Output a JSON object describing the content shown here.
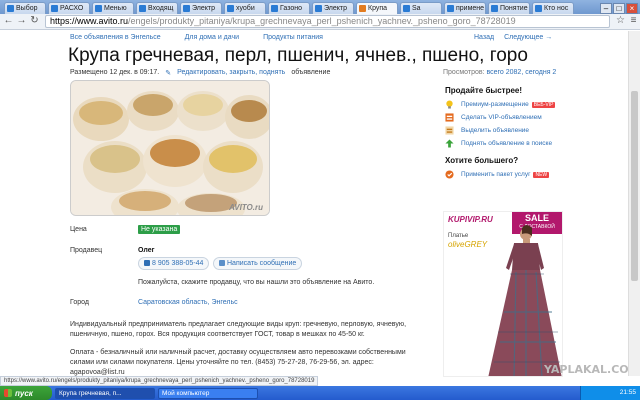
{
  "browser": {
    "tabs": [
      {
        "label": "Выбор"
      },
      {
        "label": "РАСХО"
      },
      {
        "label": "Менью"
      },
      {
        "label": "Входящ"
      },
      {
        "label": "Электр"
      },
      {
        "label": "хуоби"
      },
      {
        "label": "Газоно"
      },
      {
        "label": "Электр"
      },
      {
        "label": "Крупа"
      },
      {
        "label": "Sa"
      },
      {
        "label": "примене"
      },
      {
        "label": "Понятие"
      },
      {
        "label": "Кто нос"
      }
    ],
    "url_host": "https://www.avito.ru",
    "url_path": "/engels/produkty_pitaniya/krupa_grechnevaya_perl_pshenich_yachnev._psheno_goro_78728019",
    "status_url": "https://www.avito.ru/engels/produkty_pitaniya/krupa_grechnevaya_perl_pshenich_yachnev._psheno_goro_78728019"
  },
  "breadcrumbs": [
    "Все объявления в Энгельсе",
    "Для дома и дачи",
    "Продукты питания"
  ],
  "top_links": {
    "prev": "Назад",
    "next": "Следующее →"
  },
  "listing": {
    "title": "Крупа гречневая, перл, пшенич, ячнев., пшено, горо",
    "posted": "Размещено 12 дек. в 09:17.",
    "edit_links": "Редактировать, закрыть, поднять",
    "edit_suffix": "объявление",
    "views_label": "Просмотров:",
    "views_value": "всего 2082, сегодня 2",
    "photo_watermark": "AVITO.ru",
    "price_label": "Цена",
    "price_value": "Не указана",
    "seller_label": "Продавец",
    "seller_name": "Олег",
    "phone": "8 905 388-05-44",
    "message_button": "Написать сообщение",
    "notice": "Пожалуйста, скажите продавцу, что вы нашли это объявление на Авито.",
    "city_label": "Город",
    "city_value": "Саратовская область, Энгельс",
    "description_1": "Индивидуальный предприниматель предлагает следующие виды круп: гречневую, перловую, ячневую, пшеничную, пшено, горох. Вся продукция соответствует ГОСТ, товар в мешках по 45-50 кг.",
    "description_2": "Оплата - безналичный или наличный расчет, доставку осуществляем авто перевозками собственными силами или силами покупателя. Цены уточняйте по тел. (8453) 75-27-28, 76-29-56, эл. адрес: agapovoa@list.ru"
  },
  "sidebar": {
    "sell_title": "Продайте быстрее!",
    "items": [
      {
        "label": "Премиум-размещение",
        "badge": "ВЕБ-VIP"
      },
      {
        "label": "Сделать VIP-объявлением"
      },
      {
        "label": "Выделить объявление"
      },
      {
        "label": "Поднять объявление в поиске"
      }
    ],
    "more_title": "Хотите большего?",
    "package_label": "Применить пакет услуг",
    "package_badge": "NEW"
  },
  "ad": {
    "logo": "KUPIVIP.RU",
    "sale": "SALE",
    "sale_sub": "С ДОСТАВКОЙ",
    "caption": "Платье",
    "brand": "oliveGREY"
  },
  "watermark": "YAPLAKAL.COM",
  "taskbar": {
    "start": "пуск",
    "windows": [
      "Крупа гречневая, п...",
      "Мой компьютер"
    ],
    "clock": "21:55"
  }
}
